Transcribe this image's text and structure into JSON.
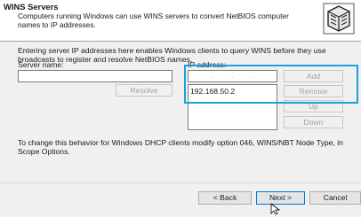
{
  "header": {
    "title": "WINS Servers",
    "description": "Computers running Windows can use WINS servers to convert NetBIOS computer names to IP addresses.",
    "icon": "wizard-server-icon"
  },
  "intro": "Entering server IP addresses here enables Windows clients to query WINS before they use broadcasts to register and resolve NetBIOS names.",
  "server_name": {
    "label": "Server name:",
    "value": ""
  },
  "ip_address": {
    "label": "IP address:",
    "value": "",
    "list": [
      "192.168.50.2"
    ]
  },
  "buttons": {
    "resolve": "Resolve",
    "add": "Add",
    "remove": "Remove",
    "up": "Up",
    "down": "Down"
  },
  "note": "To change this behavior for Windows DHCP clients modify option 046, WINS/NBT Node Type, in Scope Options.",
  "footer": {
    "back": "< Back",
    "next": "Next >",
    "cancel": "Cancel"
  },
  "colors": {
    "highlight": "#1da1d8",
    "dialog_bg": "#f0f0f0",
    "header_bg": "#ffffff"
  }
}
